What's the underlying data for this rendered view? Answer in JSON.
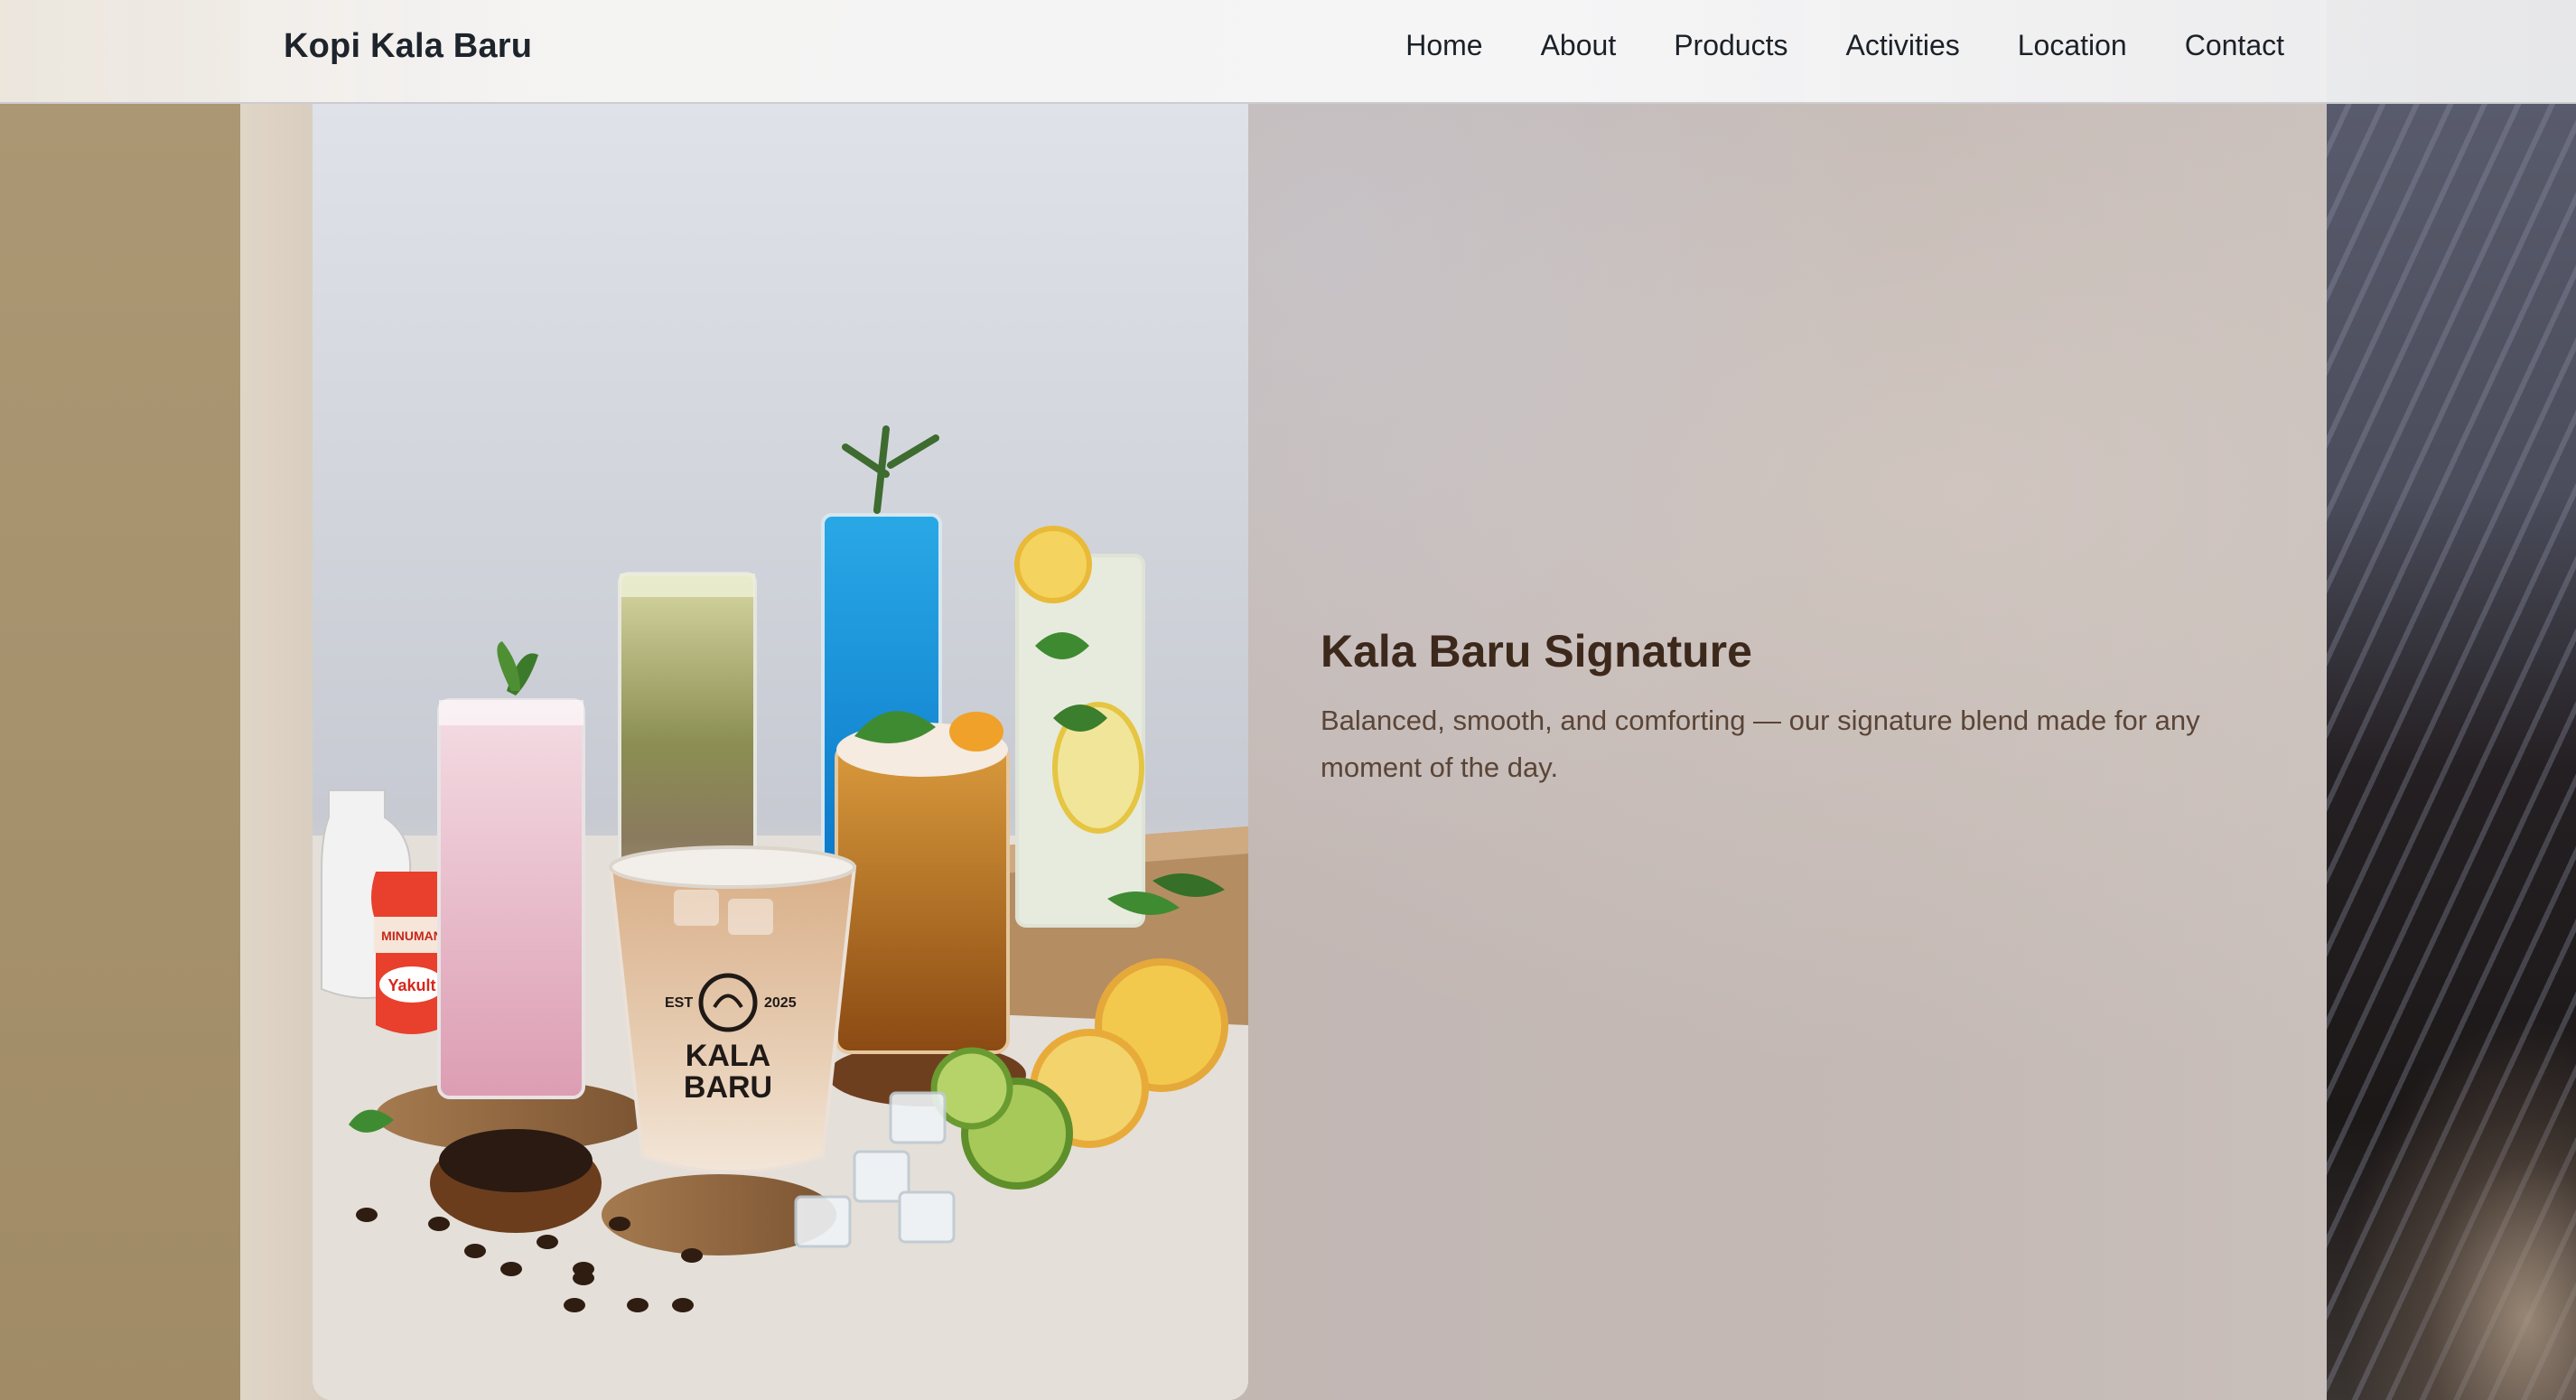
{
  "brand": {
    "name": "Kopi Kala Baru"
  },
  "nav": {
    "items": [
      {
        "label": "Home"
      },
      {
        "label": "About"
      },
      {
        "label": "Products"
      },
      {
        "label": "Activities"
      },
      {
        "label": "Location"
      },
      {
        "label": "Contact"
      }
    ]
  },
  "hero": {
    "title": "Kala Baru Signature",
    "description": "Balanced, smooth, and comforting — our signature blend made for any moment of the day.",
    "image_cup": {
      "est": "EST",
      "year": "2025",
      "name_line1": "KALA",
      "name_line2": "BARU"
    },
    "image_bottle": {
      "label_top": "MINUMAN",
      "label_brand": "Yakult"
    }
  },
  "colors": {
    "nav_background": "#f6f6f7",
    "brand_text": "#1e242c",
    "title_text": "#3d291c",
    "description_text": "#5a4537"
  }
}
